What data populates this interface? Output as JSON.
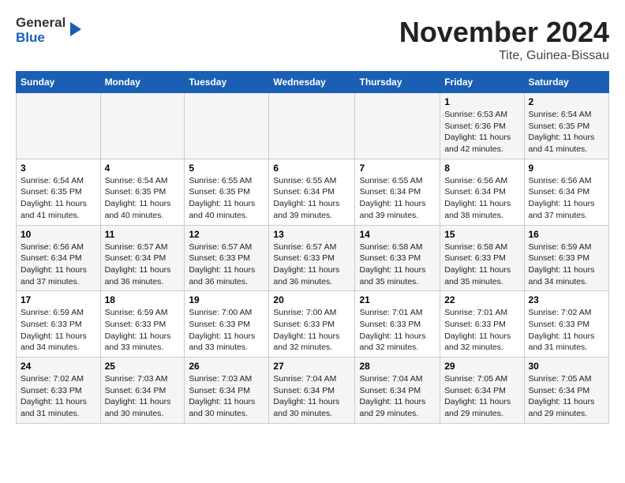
{
  "logo": {
    "line1": "General",
    "line2": "Blue"
  },
  "title": "November 2024",
  "subtitle": "Tite, Guinea-Bissau",
  "days_of_week": [
    "Sunday",
    "Monday",
    "Tuesday",
    "Wednesday",
    "Thursday",
    "Friday",
    "Saturday"
  ],
  "weeks": [
    [
      {
        "day": "",
        "sunrise": "",
        "sunset": "",
        "daylight": ""
      },
      {
        "day": "",
        "sunrise": "",
        "sunset": "",
        "daylight": ""
      },
      {
        "day": "",
        "sunrise": "",
        "sunset": "",
        "daylight": ""
      },
      {
        "day": "",
        "sunrise": "",
        "sunset": "",
        "daylight": ""
      },
      {
        "day": "",
        "sunrise": "",
        "sunset": "",
        "daylight": ""
      },
      {
        "day": "1",
        "sunrise": "Sunrise: 6:53 AM",
        "sunset": "Sunset: 6:36 PM",
        "daylight": "Daylight: 11 hours and 42 minutes."
      },
      {
        "day": "2",
        "sunrise": "Sunrise: 6:54 AM",
        "sunset": "Sunset: 6:35 PM",
        "daylight": "Daylight: 11 hours and 41 minutes."
      }
    ],
    [
      {
        "day": "3",
        "sunrise": "Sunrise: 6:54 AM",
        "sunset": "Sunset: 6:35 PM",
        "daylight": "Daylight: 11 hours and 41 minutes."
      },
      {
        "day": "4",
        "sunrise": "Sunrise: 6:54 AM",
        "sunset": "Sunset: 6:35 PM",
        "daylight": "Daylight: 11 hours and 40 minutes."
      },
      {
        "day": "5",
        "sunrise": "Sunrise: 6:55 AM",
        "sunset": "Sunset: 6:35 PM",
        "daylight": "Daylight: 11 hours and 40 minutes."
      },
      {
        "day": "6",
        "sunrise": "Sunrise: 6:55 AM",
        "sunset": "Sunset: 6:34 PM",
        "daylight": "Daylight: 11 hours and 39 minutes."
      },
      {
        "day": "7",
        "sunrise": "Sunrise: 6:55 AM",
        "sunset": "Sunset: 6:34 PM",
        "daylight": "Daylight: 11 hours and 39 minutes."
      },
      {
        "day": "8",
        "sunrise": "Sunrise: 6:56 AM",
        "sunset": "Sunset: 6:34 PM",
        "daylight": "Daylight: 11 hours and 38 minutes."
      },
      {
        "day": "9",
        "sunrise": "Sunrise: 6:56 AM",
        "sunset": "Sunset: 6:34 PM",
        "daylight": "Daylight: 11 hours and 37 minutes."
      }
    ],
    [
      {
        "day": "10",
        "sunrise": "Sunrise: 6:56 AM",
        "sunset": "Sunset: 6:34 PM",
        "daylight": "Daylight: 11 hours and 37 minutes."
      },
      {
        "day": "11",
        "sunrise": "Sunrise: 6:57 AM",
        "sunset": "Sunset: 6:34 PM",
        "daylight": "Daylight: 11 hours and 36 minutes."
      },
      {
        "day": "12",
        "sunrise": "Sunrise: 6:57 AM",
        "sunset": "Sunset: 6:33 PM",
        "daylight": "Daylight: 11 hours and 36 minutes."
      },
      {
        "day": "13",
        "sunrise": "Sunrise: 6:57 AM",
        "sunset": "Sunset: 6:33 PM",
        "daylight": "Daylight: 11 hours and 36 minutes."
      },
      {
        "day": "14",
        "sunrise": "Sunrise: 6:58 AM",
        "sunset": "Sunset: 6:33 PM",
        "daylight": "Daylight: 11 hours and 35 minutes."
      },
      {
        "day": "15",
        "sunrise": "Sunrise: 6:58 AM",
        "sunset": "Sunset: 6:33 PM",
        "daylight": "Daylight: 11 hours and 35 minutes."
      },
      {
        "day": "16",
        "sunrise": "Sunrise: 6:59 AM",
        "sunset": "Sunset: 6:33 PM",
        "daylight": "Daylight: 11 hours and 34 minutes."
      }
    ],
    [
      {
        "day": "17",
        "sunrise": "Sunrise: 6:59 AM",
        "sunset": "Sunset: 6:33 PM",
        "daylight": "Daylight: 11 hours and 34 minutes."
      },
      {
        "day": "18",
        "sunrise": "Sunrise: 6:59 AM",
        "sunset": "Sunset: 6:33 PM",
        "daylight": "Daylight: 11 hours and 33 minutes."
      },
      {
        "day": "19",
        "sunrise": "Sunrise: 7:00 AM",
        "sunset": "Sunset: 6:33 PM",
        "daylight": "Daylight: 11 hours and 33 minutes."
      },
      {
        "day": "20",
        "sunrise": "Sunrise: 7:00 AM",
        "sunset": "Sunset: 6:33 PM",
        "daylight": "Daylight: 11 hours and 32 minutes."
      },
      {
        "day": "21",
        "sunrise": "Sunrise: 7:01 AM",
        "sunset": "Sunset: 6:33 PM",
        "daylight": "Daylight: 11 hours and 32 minutes."
      },
      {
        "day": "22",
        "sunrise": "Sunrise: 7:01 AM",
        "sunset": "Sunset: 6:33 PM",
        "daylight": "Daylight: 11 hours and 32 minutes."
      },
      {
        "day": "23",
        "sunrise": "Sunrise: 7:02 AM",
        "sunset": "Sunset: 6:33 PM",
        "daylight": "Daylight: 11 hours and 31 minutes."
      }
    ],
    [
      {
        "day": "24",
        "sunrise": "Sunrise: 7:02 AM",
        "sunset": "Sunset: 6:33 PM",
        "daylight": "Daylight: 11 hours and 31 minutes."
      },
      {
        "day": "25",
        "sunrise": "Sunrise: 7:03 AM",
        "sunset": "Sunset: 6:34 PM",
        "daylight": "Daylight: 11 hours and 30 minutes."
      },
      {
        "day": "26",
        "sunrise": "Sunrise: 7:03 AM",
        "sunset": "Sunset: 6:34 PM",
        "daylight": "Daylight: 11 hours and 30 minutes."
      },
      {
        "day": "27",
        "sunrise": "Sunrise: 7:04 AM",
        "sunset": "Sunset: 6:34 PM",
        "daylight": "Daylight: 11 hours and 30 minutes."
      },
      {
        "day": "28",
        "sunrise": "Sunrise: 7:04 AM",
        "sunset": "Sunset: 6:34 PM",
        "daylight": "Daylight: 11 hours and 29 minutes."
      },
      {
        "day": "29",
        "sunrise": "Sunrise: 7:05 AM",
        "sunset": "Sunset: 6:34 PM",
        "daylight": "Daylight: 11 hours and 29 minutes."
      },
      {
        "day": "30",
        "sunrise": "Sunrise: 7:05 AM",
        "sunset": "Sunset: 6:34 PM",
        "daylight": "Daylight: 11 hours and 29 minutes."
      }
    ]
  ]
}
